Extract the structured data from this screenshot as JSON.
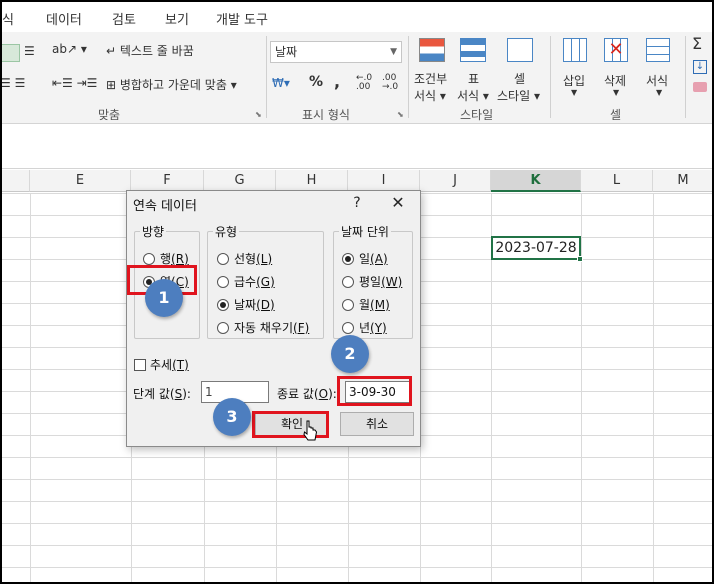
{
  "ribbon": {
    "tabs": [
      "식",
      "데이터",
      "검토",
      "보기",
      "개발 도구"
    ],
    "wrap_text": "텍스트 줄 바꿈",
    "merge_center": "병합하고 가운데 맞춤",
    "number_format": "날짜",
    "percent": "%",
    "comma": ",",
    "group_align": "맞춤",
    "group_number": "표시 형식",
    "group_style": "스타일",
    "group_cells": "셀",
    "cond_format_1": "조건부",
    "cond_format_2": "서식",
    "table_1": "표",
    "table_2": "서식",
    "cell_style_1": "셀",
    "cell_style_2": "스타일",
    "insert": "삽입",
    "delete": "삭제",
    "format": "서식"
  },
  "columns": [
    "E",
    "F",
    "G",
    "H",
    "I",
    "J",
    "K",
    "L",
    "M"
  ],
  "cell_k": "2023-07-28",
  "dialog": {
    "title": "연속 데이터",
    "help": "?",
    "close": "✕",
    "direction_title": "방향",
    "direction_row": "행",
    "direction_row_key": "(R)",
    "direction_col": "열",
    "direction_col_key": "(C)",
    "type_title": "유형",
    "type_linear": "선형",
    "type_linear_key": "(L)",
    "type_growth": "급수",
    "type_growth_key": "(G)",
    "type_date": "날짜",
    "type_date_key": "(D)",
    "type_autofill": "자동 채우기",
    "type_autofill_key": "(F)",
    "date_unit_title": "날짜 단위",
    "unit_day": "일",
    "unit_day_key": "(A)",
    "unit_weekday": "평일",
    "unit_weekday_key": "(W)",
    "unit_month": "월",
    "unit_month_key": "(M)",
    "unit_year": "년",
    "unit_year_key": "(Y)",
    "trend": "추세",
    "trend_key": "(T)",
    "step_label": "단계 값(",
    "step_key": "S",
    "step_label_end": "):",
    "step_value": "1",
    "stop_label": "종료 값(",
    "stop_key": "O",
    "stop_label_end": "):",
    "stop_value": "3-09-30",
    "ok": "확인",
    "cancel": "취소"
  },
  "callouts": [
    "1",
    "2",
    "3"
  ],
  "colors": {
    "highlight": "#e0141e",
    "badge": "#4d7ebf",
    "excel_green": "#217346"
  }
}
